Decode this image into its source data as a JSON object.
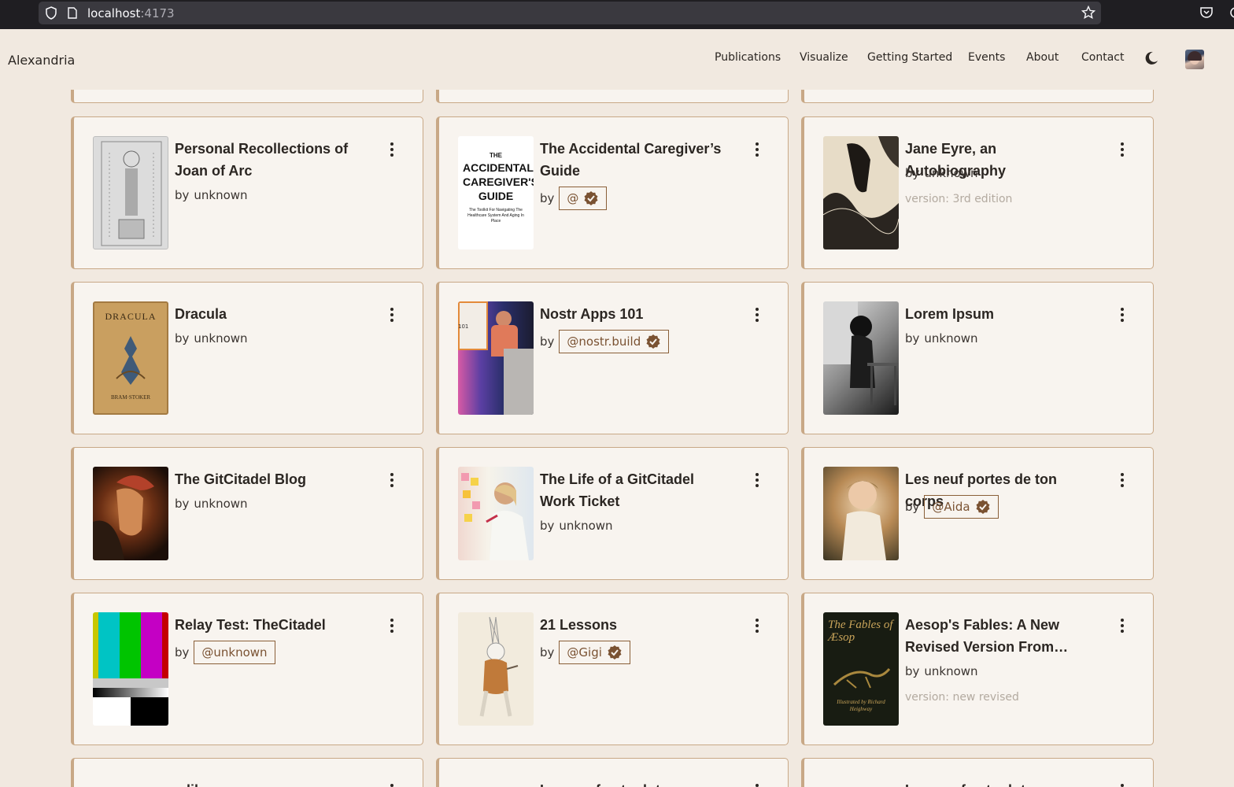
{
  "browser": {
    "url_host": "localhost",
    "url_port": ":4173"
  },
  "nav": {
    "brand": "Alexandria",
    "links": [
      "Publications",
      "Visualize",
      "Getting Started",
      "Events",
      "About",
      "Contact"
    ]
  },
  "cards": [
    {
      "title": "Personal Recollections of Joan of Arc",
      "by": "by",
      "author": "unknown",
      "verified": false
    },
    {
      "title": "The Accidental Caregiver’s Guide",
      "by": "by",
      "author": "@",
      "verified": true,
      "cover_text": {
        "top": "THE",
        "main": "ACCIDENTAL CAREGIVER'S GUIDE",
        "sub": "The Toolkit For Navigating The Healthcare System And Aging In Place"
      }
    },
    {
      "title": "Jane Eyre, an Autobiography",
      "by": "by",
      "author": "unknown",
      "verified": false,
      "version": "version: 3rd edition"
    },
    {
      "title": "Dracula",
      "by": "by",
      "author": "unknown",
      "verified": false,
      "cover_text": {
        "top": "DRACULA",
        "bottom": "BRAM·STOKER"
      }
    },
    {
      "title": "Nostr Apps 101",
      "by": "by",
      "author": "@nostr.build",
      "verified": true,
      "cover_text": {
        "label": "101"
      }
    },
    {
      "title": "Lorem Ipsum",
      "by": "by",
      "author": "unknown",
      "verified": false
    },
    {
      "title": "The GitCitadel Blog",
      "by": "by",
      "author": "unknown",
      "verified": false
    },
    {
      "title": "The Life of a GitCitadel Work Ticket",
      "by": "by",
      "author": "unknown",
      "verified": false
    },
    {
      "title": "Les neuf portes de ton corps",
      "by": "by",
      "author": "@Aida",
      "verified": true
    },
    {
      "title": "Relay Test: TheCitadel",
      "by": "by",
      "author": "@unknown",
      "verified": false
    },
    {
      "title": "21 Lessons",
      "by": "by",
      "author": "@Gigi",
      "verified": true
    },
    {
      "title": "Aesop's Fables: A New Revised Version From…",
      "by": "by",
      "author": "unknown",
      "verified": false,
      "version": "version: new revised",
      "cover_text": {
        "top": "The Fables of Æsop",
        "bottom": "Illustrated by Richard Heighway"
      }
    }
  ],
  "partial_titles": [
    "...libre..",
    "Lorem of autoplot...",
    "Lorem of autoplot..."
  ],
  "colors": {
    "accent": "#8a5f38",
    "card_border": "#c8a886",
    "background": "#f1e9e0"
  }
}
